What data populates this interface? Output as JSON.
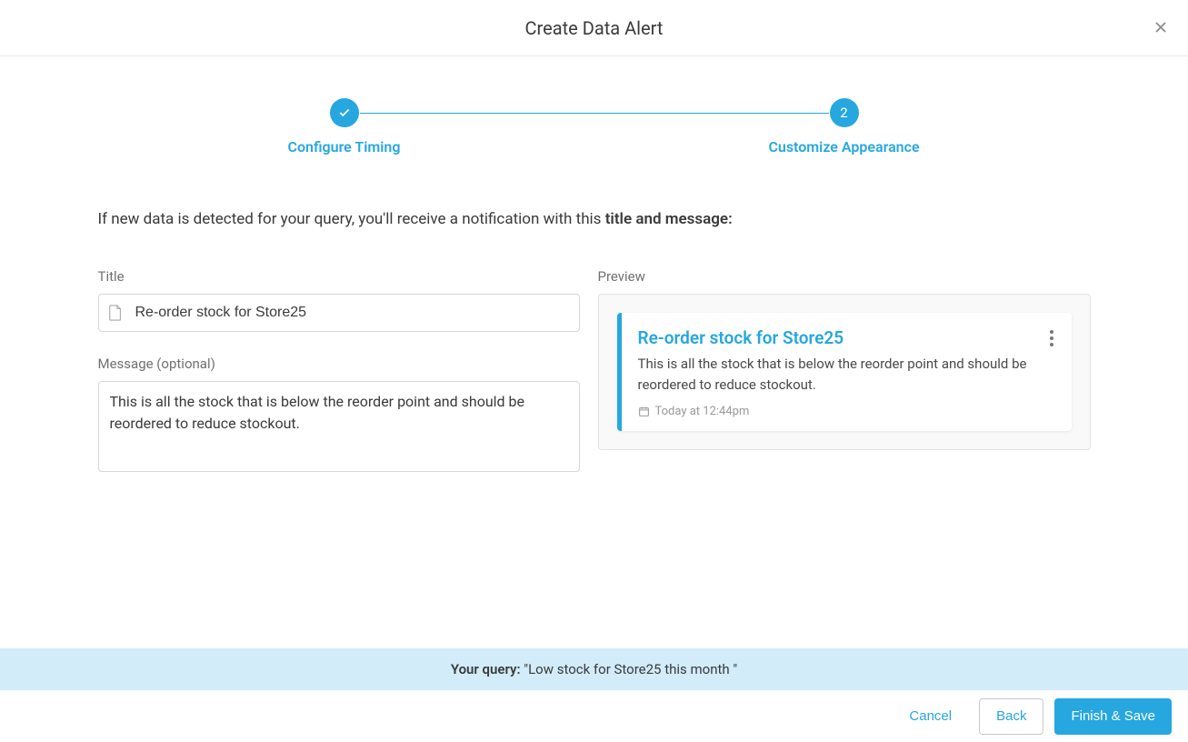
{
  "header": {
    "title": "Create Data Alert"
  },
  "stepper": {
    "step1": {
      "label": "Configure Timing",
      "completed": true
    },
    "step2": {
      "label": "Customize Appearance",
      "number": "2"
    }
  },
  "instruction": {
    "prefix": "If new data is detected for your query, you'll receive a notification with this ",
    "bold": "title and message:"
  },
  "form": {
    "title_label": "Title",
    "title_value": "Re-order stock for Store25",
    "message_label": "Message (optional)",
    "message_value": "This is all the stock that is below the reorder point and should be reordered to reduce stockout."
  },
  "preview": {
    "label": "Preview",
    "card_title": "Re-order stock for Store25",
    "card_message": "This is all the stock that is below the reorder point and should be reordered to reduce stockout.",
    "card_timestamp": "Today at 12:44pm"
  },
  "query": {
    "label": "Your query:",
    "text": " \"Low stock for Store25 this month \""
  },
  "buttons": {
    "cancel": "Cancel",
    "back": "Back",
    "finish": "Finish & Save"
  }
}
